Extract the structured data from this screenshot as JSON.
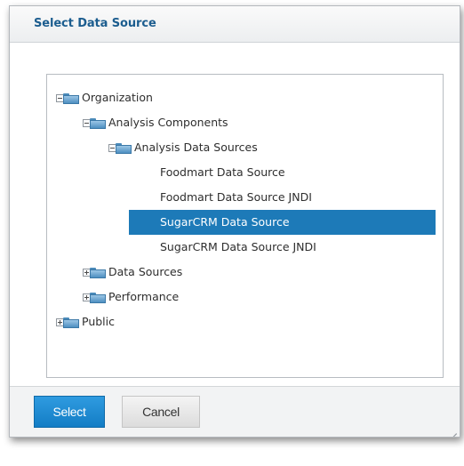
{
  "dialog": {
    "title": "Select Data Source"
  },
  "tree": {
    "nodes": [
      {
        "label": "Organization",
        "level": 0,
        "expander": "minus",
        "folder": true
      },
      {
        "label": "Analysis Components",
        "level": 1,
        "expander": "minus",
        "folder": true
      },
      {
        "label": "Analysis Data Sources",
        "level": 2,
        "expander": "minus",
        "folder": true
      },
      {
        "label": "Foodmart Data Source",
        "level": 3,
        "folder": false
      },
      {
        "label": "Foodmart Data Source JNDI",
        "level": 3,
        "folder": false
      },
      {
        "label": "SugarCRM Data Source",
        "level": 3,
        "folder": false,
        "selected": true
      },
      {
        "label": "SugarCRM Data Source JNDI",
        "level": 3,
        "folder": false
      },
      {
        "label": "Data Sources",
        "level": 1,
        "expander": "plus",
        "folder": true
      },
      {
        "label": "Performance",
        "level": 1,
        "expander": "plus",
        "folder": true
      },
      {
        "label": "Public",
        "level": 0,
        "expander": "plus",
        "folder": true
      }
    ]
  },
  "buttons": {
    "select_label": "Select",
    "cancel_label": "Cancel"
  },
  "colors": {
    "title": "#1c5d8f",
    "selection": "#1d7ab8",
    "primary_button": "#1a86cf"
  }
}
